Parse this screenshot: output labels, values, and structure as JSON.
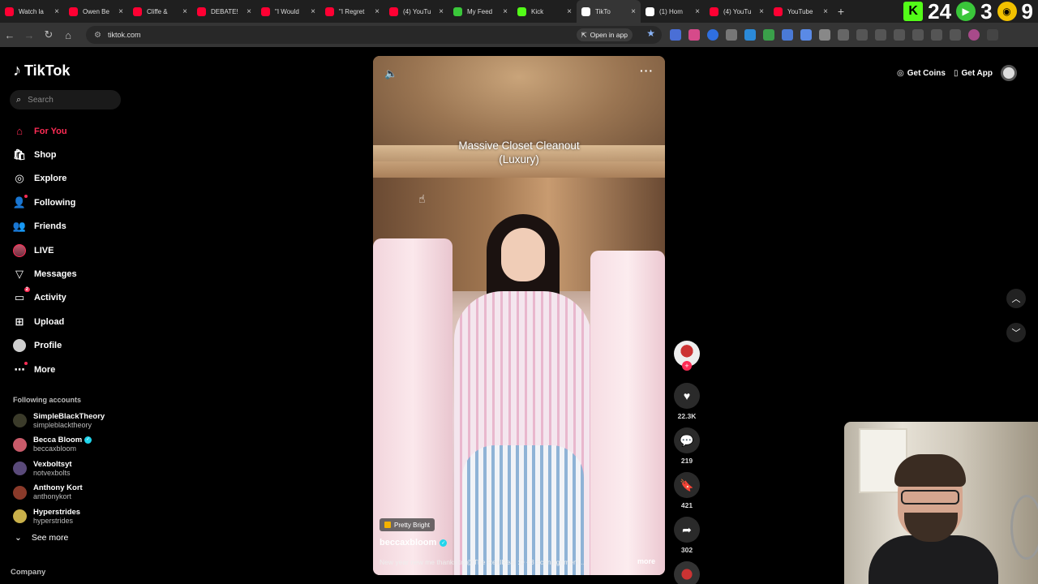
{
  "browser": {
    "tabs": [
      {
        "label": "Watch la",
        "color": "#ff0033"
      },
      {
        "label": "Owen Be",
        "color": "#ff0033"
      },
      {
        "label": "Cliffe &",
        "color": "#ff0033"
      },
      {
        "label": "DEBATE!",
        "color": "#ff0033"
      },
      {
        "label": "\"I Would",
        "color": "#ff0033"
      },
      {
        "label": "\"I Regret",
        "color": "#ff0033"
      },
      {
        "label": "(4) YouTu",
        "color": "#ff0033"
      },
      {
        "label": "My Feed",
        "color": "#3ac73a"
      },
      {
        "label": "Kick",
        "color": "#53fc18"
      },
      {
        "label": "TikTo",
        "color": "#ffffff",
        "active": true
      },
      {
        "label": "(1) Hom",
        "color": "#ffffff"
      },
      {
        "label": "(4) YouTu",
        "color": "#ff0033"
      },
      {
        "label": "YouTube",
        "color": "#ff0033"
      }
    ],
    "new_tab": "+",
    "overlay_numbers": {
      "a": "24",
      "b": "3",
      "c": "9"
    },
    "url": "tiktok.com",
    "open_in_app": "Open in app"
  },
  "tiktok": {
    "logo": "TikTok",
    "search_placeholder": "Search",
    "nav": [
      {
        "label": "For You",
        "icon": "home-icon",
        "glyph": "⌂",
        "active": true
      },
      {
        "label": "Shop",
        "icon": "shop-icon",
        "glyph": "🛍"
      },
      {
        "label": "Explore",
        "icon": "compass-icon",
        "glyph": "◎"
      },
      {
        "label": "Following",
        "icon": "following-icon",
        "glyph": "👤",
        "dot": true
      },
      {
        "label": "Friends",
        "icon": "friends-icon",
        "glyph": "👥"
      },
      {
        "label": "LIVE",
        "icon": "live-icon",
        "glyph": ""
      },
      {
        "label": "Messages",
        "icon": "messages-icon",
        "glyph": "▽"
      },
      {
        "label": "Activity",
        "icon": "activity-icon",
        "glyph": "▭",
        "badge": "2"
      },
      {
        "label": "Upload",
        "icon": "upload-icon",
        "glyph": "⊞"
      },
      {
        "label": "Profile",
        "icon": "profile-icon",
        "glyph": ""
      },
      {
        "label": "More",
        "icon": "more-icon",
        "glyph": "⋯",
        "dot": true
      }
    ],
    "following_title": "Following accounts",
    "following": [
      {
        "name": "SimpleBlackTheory",
        "handle": "simpleblacktheory",
        "color": "#3b3b2a",
        "verified": false
      },
      {
        "name": "Becca Bloom",
        "handle": "beccaxbloom",
        "color": "#c95b6a",
        "verified": true
      },
      {
        "name": "Vexboltsyt",
        "handle": "notvexbolts",
        "color": "#5a4a7a",
        "verified": false
      },
      {
        "name": "Anthony Kort",
        "handle": "anthonykort",
        "color": "#8a3a2a",
        "verified": false
      },
      {
        "name": "Hyperstrides",
        "handle": "hyperstrides",
        "color": "#c9b04a",
        "verified": false
      }
    ],
    "see_more": "See more",
    "company": "Company",
    "get_coins": "Get Coins",
    "get_app": "Get App"
  },
  "video": {
    "overlay_title": "Massive Closet Cleanout",
    "overlay_sub": "(Luxury)",
    "music_tag": "Pretty Bright",
    "author": "beccaxbloom",
    "description": "New year new me thanks to @The RealReal :D <3 #consignment ...",
    "more": "more",
    "likes": "22.3K",
    "comments": "219",
    "saves": "421",
    "shares": "302"
  }
}
